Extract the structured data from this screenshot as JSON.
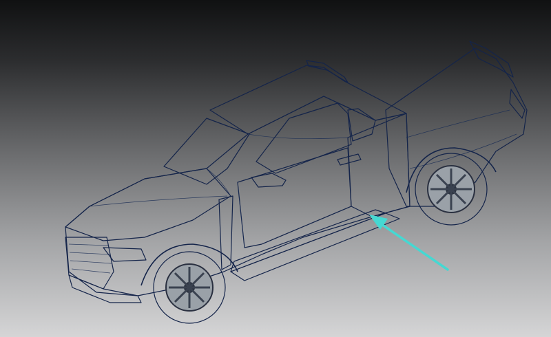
{
  "viewport": {
    "background_top": "#101112",
    "background_bottom": "#d5d5d6"
  },
  "model": {
    "subject": "pickup-truck-cad-model",
    "body_color": "#3a4f9a",
    "glass_color": "#9fb8c9",
    "highlight_region_color": "#2a2fb8",
    "running_board_color": "#4fc6b8",
    "wheel_color": "#8e949a"
  },
  "annotation": {
    "icon": "arrow-icon",
    "color": "#45d8d2"
  }
}
